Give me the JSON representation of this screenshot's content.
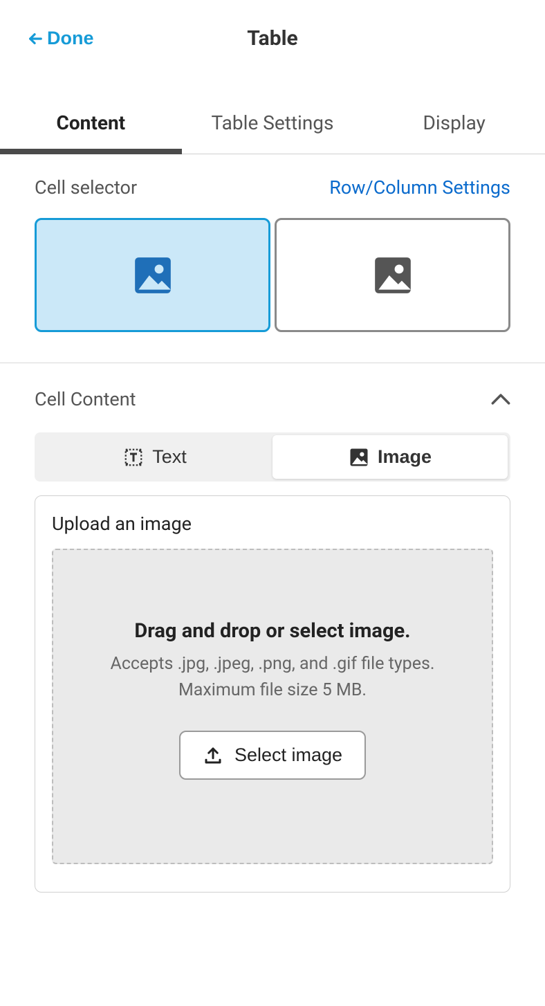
{
  "header": {
    "done_label": "Done",
    "title": "Table"
  },
  "tabs": [
    {
      "label": "Content",
      "active": true
    },
    {
      "label": "Table Settings",
      "active": false
    },
    {
      "label": "Display",
      "active": false
    }
  ],
  "cell_selector": {
    "label": "Cell selector",
    "link": "Row/Column Settings",
    "cells": [
      {
        "type": "image",
        "selected": true
      },
      {
        "type": "image",
        "selected": false
      }
    ]
  },
  "cell_content": {
    "label": "Cell Content",
    "options": {
      "text_label": "Text",
      "image_label": "Image",
      "active": "image"
    },
    "upload": {
      "title": "Upload an image",
      "dropzone_title": "Drag and drop or select image.",
      "dropzone_sub_line1": "Accepts .jpg, .jpeg, .png, and .gif file types.",
      "dropzone_sub_line2": "Maximum file size 5 MB.",
      "select_button": "Select image"
    }
  }
}
